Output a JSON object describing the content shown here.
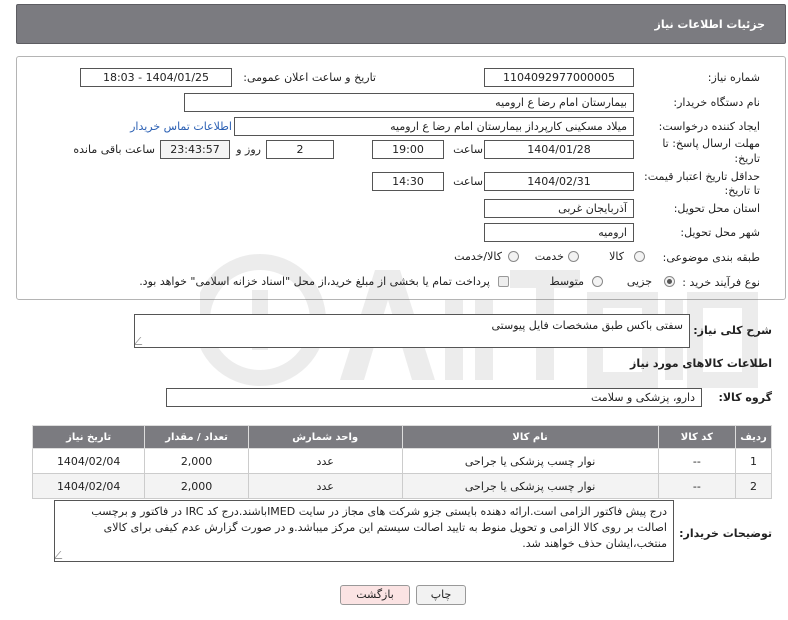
{
  "header": {
    "title": "جزئیات اطلاعات نیاز"
  },
  "form": {
    "need_number_label": "شماره نیاز:",
    "need_number": "1104092977000005",
    "announce_label": "تاریخ و ساعت اعلان عمومی:",
    "announce_value": "1404/01/25 - 18:03",
    "buyer_org_label": "نام دستگاه خریدار:",
    "buyer_org": "بیمارستان امام رضا  ع  ارومیه",
    "requester_label": "ایجاد کننده درخواست:",
    "requester": "میلاد مسکینی کارپرداز بیمارستان امام رضا  ع  ارومیه",
    "contact_link": "اطلاعات تماس خریدار",
    "reply_deadline_label_1": "مهلت ارسال پاسخ: تا",
    "reply_deadline_label_2": "تاریخ:",
    "reply_date": "1404/01/28",
    "time_label": "ساعت",
    "reply_time": "19:00",
    "days_value": "2",
    "days_label": "روز و",
    "remaining_time": "23:43:57",
    "remaining_label": "ساعت باقی مانده",
    "price_deadline_label_1": "حداقل تاریخ اعتبار قیمت:",
    "price_deadline_label_2": "تا تاریخ:",
    "price_date": "1404/02/31",
    "price_time": "14:30",
    "province_label": "استان محل تحویل:",
    "province": "آذربایجان غربی",
    "city_label": "شهر محل تحویل:",
    "city": "ارومیه",
    "category_label": "طبقه بندی موضوعی:",
    "category_options": [
      "کالا",
      "خدمت",
      "کالا/خدمت"
    ],
    "category_selected": "کالا",
    "purchase_type_label": "نوع فرآیند خرید :",
    "purchase_options": [
      "جزیی",
      "متوسط"
    ],
    "purchase_selected": "جزیی",
    "payment_note": "پرداخت تمام یا بخشی از مبلغ خرید،از محل \"اسناد خزانه اسلامی\" خواهد بود."
  },
  "description": {
    "label": "شرح کلی نیاز:",
    "text": "سفتی باکس طبق مشخصات فایل پیوستی"
  },
  "goods": {
    "section_title": "اطلاعات کالاهای مورد نیاز",
    "group_label": "گروه کالا:",
    "group_value": "دارو، پزشکی و سلامت",
    "columns": [
      "ردیف",
      "کد کالا",
      "نام کالا",
      "واحد شمارش",
      "تعداد / مقدار",
      "تاریخ نیاز"
    ],
    "rows": [
      [
        "1",
        "--",
        "نوار چسب پزشکی یا جراحی",
        "عدد",
        "2,000",
        "1404/02/04"
      ],
      [
        "2",
        "--",
        "نوار چسب پزشکی یا جراحی",
        "عدد",
        "2,000",
        "1404/02/04"
      ]
    ]
  },
  "buyer_notes": {
    "label": "توضیحات خریدار:",
    "text": "درج پیش فاکتور الزامی است.ارائه دهنده بایستی جزو شرکت های مجاز در سایت IMEDباشند.درج کد IRC در فاکتور و برچسب اصالت بر روی کالا الزامی و تحویل منوط به تایید اصالت سیستم این مرکز میباشد.و در صورت گزارش عدم کیفی برای کالای منتخب،ایشان حذف خواهند شد."
  },
  "buttons": {
    "print": "چاپ",
    "back": "بازگشت"
  },
  "colors": {
    "header_bg": "#7b7b80",
    "link": "#2a5fb3",
    "back_button_bg": "#fbe3e3"
  }
}
